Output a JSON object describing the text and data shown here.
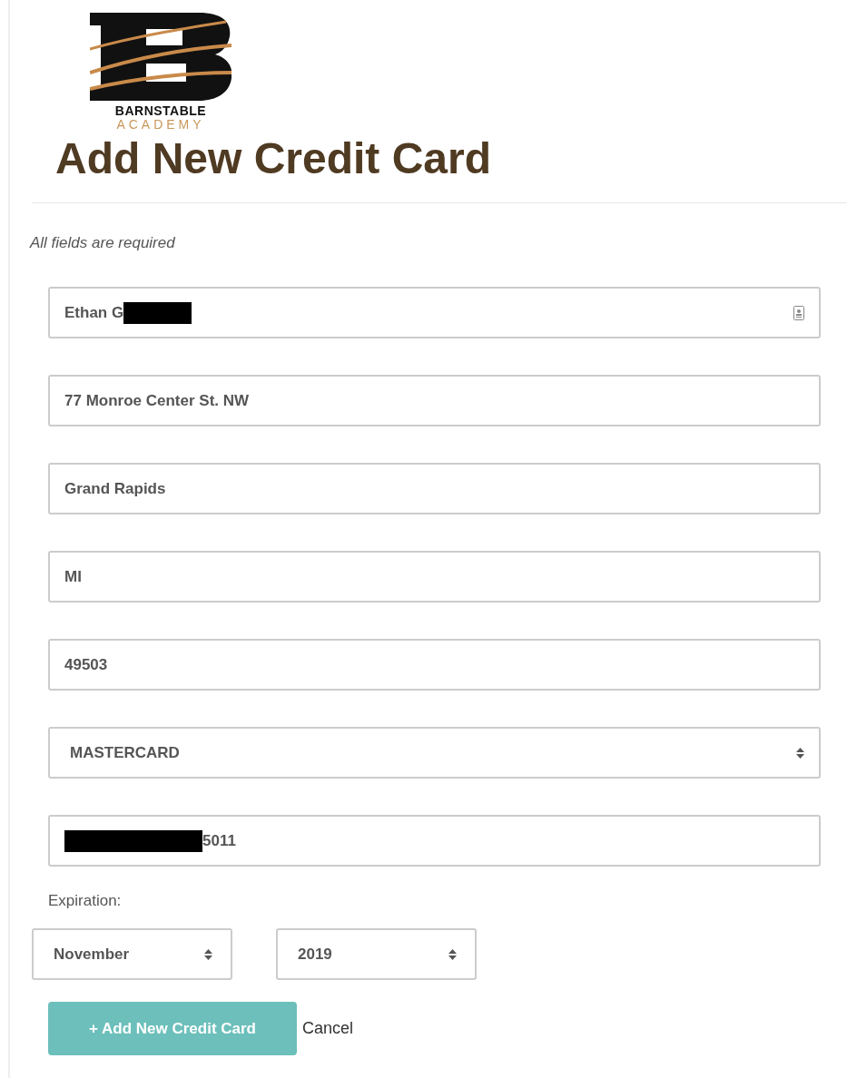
{
  "logo": {
    "name": "BARNSTABLE",
    "subtitle": "ACADEMY"
  },
  "title": "Add New Credit Card",
  "note": "All fields are required",
  "fields": [
    {
      "kind": "text",
      "value": "Ethan G",
      "redacted_before": false,
      "redacted_after": true,
      "contact_icon": true
    },
    {
      "kind": "text",
      "value": "77 Monroe Center St. NW",
      "redacted_before": false,
      "redacted_after": false,
      "contact_icon": false
    },
    {
      "kind": "text",
      "value": "Grand Rapids",
      "redacted_before": false,
      "redacted_after": false,
      "contact_icon": false
    },
    {
      "kind": "text",
      "value": "MI",
      "redacted_before": false,
      "redacted_after": false,
      "contact_icon": false
    },
    {
      "kind": "text",
      "value": "49503",
      "redacted_before": false,
      "redacted_after": false,
      "contact_icon": false
    },
    {
      "kind": "select",
      "value": "MASTERCARD",
      "redacted_before": false,
      "redacted_after": false,
      "contact_icon": false
    },
    {
      "kind": "text",
      "value": "5011",
      "redacted_before": true,
      "redacted_after": false,
      "contact_icon": false
    }
  ],
  "expiration": {
    "label": "Expiration:",
    "month": "November",
    "year": "2019"
  },
  "buttons": {
    "submit": "+ Add New Credit Card",
    "cancel": "Cancel"
  }
}
